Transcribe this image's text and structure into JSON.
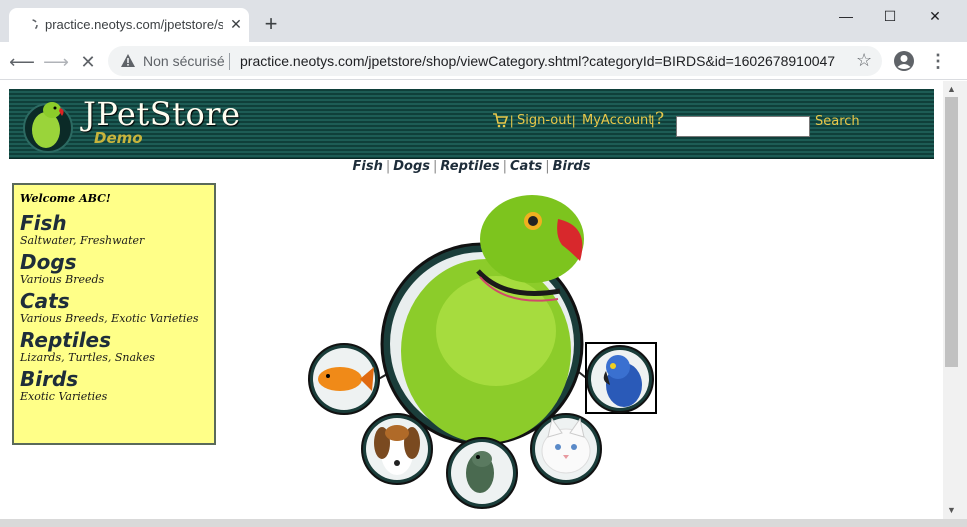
{
  "browser": {
    "tab_title": "practice.neotys.com/jpetstore/sh",
    "new_tab": "+",
    "security_label": "Non sécurisé",
    "url": "practice.neotys.com/jpetstore/shop/viewCategory.shtml?categoryId=BIRDS&id=1602678910047",
    "icons": [
      "back-icon",
      "forward-icon",
      "stop-icon",
      "warning-icon",
      "star-icon",
      "profile-icon",
      "menu-icon"
    ]
  },
  "header": {
    "logo_title": "JPetStore",
    "logo_sub": "Demo",
    "sign_out": "Sign-out",
    "my_account": "MyAccount",
    "help": "?",
    "search_label": "Search",
    "search_value": ""
  },
  "quicklinks": [
    "Fish",
    "Dogs",
    "Reptiles",
    "Cats",
    "Birds"
  ],
  "sidebar": {
    "welcome": "Welcome ABC!",
    "categories": [
      {
        "name": "Fish",
        "desc": "Saltwater, Freshwater"
      },
      {
        "name": "Dogs",
        "desc": "Various Breeds"
      },
      {
        "name": "Cats",
        "desc": "Various Breeds, Exotic Varieties"
      },
      {
        "name": "Reptiles",
        "desc": "Lizards, Turtles, Snakes"
      },
      {
        "name": "Birds",
        "desc": "Exotic Varieties"
      }
    ]
  },
  "colors": {
    "header_bg": "#0f3f3a",
    "header_link": "#e8c84a",
    "sidebar_bg": "#ffff88",
    "parrot_green": "#8ccc2a"
  }
}
